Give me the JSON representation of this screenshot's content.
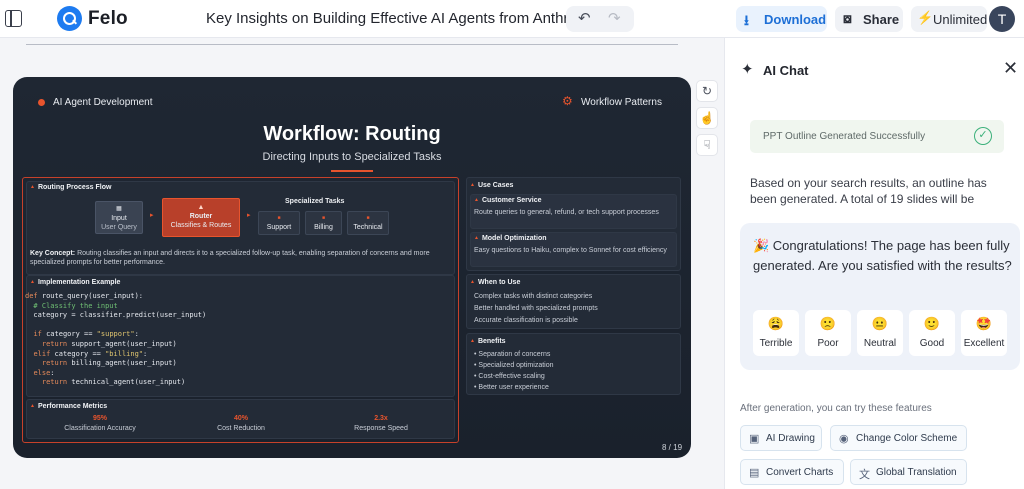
{
  "app": {
    "name": "Felo",
    "doc_title": "Key Insights on Building Effective AI Agents from Anthropic"
  },
  "toolbar": {
    "undo_icon": "undo-icon",
    "redo_icon": "redo-icon",
    "download_label": "Download",
    "share_label": "Share",
    "unlimited_label": "Unlimited",
    "avatar_initial": "T"
  },
  "slide": {
    "brand": "AI Agent Development",
    "pattern_label": "Workflow Patterns",
    "title": "Workflow: Routing",
    "subtitle": "Directing Inputs to Specialized Tasks",
    "routing": {
      "heading": "Routing Process Flow",
      "input_title": "Input",
      "input_sub": "User Query",
      "router_title": "Router",
      "router_sub": "Classifies & Routes",
      "tasks_heading": "Specialized Tasks",
      "tasks": [
        "Support",
        "Billing",
        "Technical"
      ],
      "key_concept_label": "Key Concept:",
      "key_concept": "Routing classifies an input and directs it to a specialized follow-up task, enabling separation of concerns and more specialized prompts for better performance."
    },
    "impl": {
      "heading": "Implementation Example",
      "code": [
        "def route_query(user_input):",
        "  # Classify the input",
        "  category = classifier.predict(user_input)",
        "",
        "  if category == \"support\":",
        "    return support_agent(user_input)",
        "  elif category == \"billing\":",
        "    return billing_agent(user_input)",
        "  else:",
        "    return technical_agent(user_input)"
      ]
    },
    "metrics": {
      "heading": "Performance Metrics",
      "items": [
        {
          "value": "95%",
          "label": "Classification Accuracy"
        },
        {
          "value": "40%",
          "label": "Cost Reduction"
        },
        {
          "value": "2.3x",
          "label": "Response Speed"
        }
      ]
    },
    "use_cases": {
      "heading": "Use Cases",
      "items": [
        {
          "title": "Customer Service",
          "text": "Route queries to general, refund, or tech support processes"
        },
        {
          "title": "Model Optimization",
          "text": "Easy questions to Haiku, complex to Sonnet for cost efficiency"
        }
      ]
    },
    "when": {
      "heading": "When to Use",
      "items": [
        "Complex tasks with distinct categories",
        "Better handled with specialized prompts",
        "Accurate classification is possible"
      ]
    },
    "benefits": {
      "heading": "Benefits",
      "items": [
        "Separation of concerns",
        "Specialized optimization",
        "Cost-effective scaling",
        "Better user experience"
      ]
    },
    "page_num": "8 / 19"
  },
  "chat": {
    "title": "AI Chat",
    "success": "PPT Outline Generated Successfully",
    "message": "Based on your search results, an outline has been generated. A total of 19 slides will be",
    "congrats": "🎉 Congratulations! The page has been fully generated. Are you satisfied with the results?",
    "ratings": [
      {
        "emoji": "😩",
        "label": "Terrible"
      },
      {
        "emoji": "🙁",
        "label": "Poor"
      },
      {
        "emoji": "😐",
        "label": "Neutral"
      },
      {
        "emoji": "🙂",
        "label": "Good"
      },
      {
        "emoji": "🤩",
        "label": "Excellent"
      }
    ],
    "after_label": "After generation, you can try these features",
    "features": [
      "AI Drawing",
      "Change Color Scheme",
      "Convert Charts",
      "Global Translation"
    ]
  }
}
